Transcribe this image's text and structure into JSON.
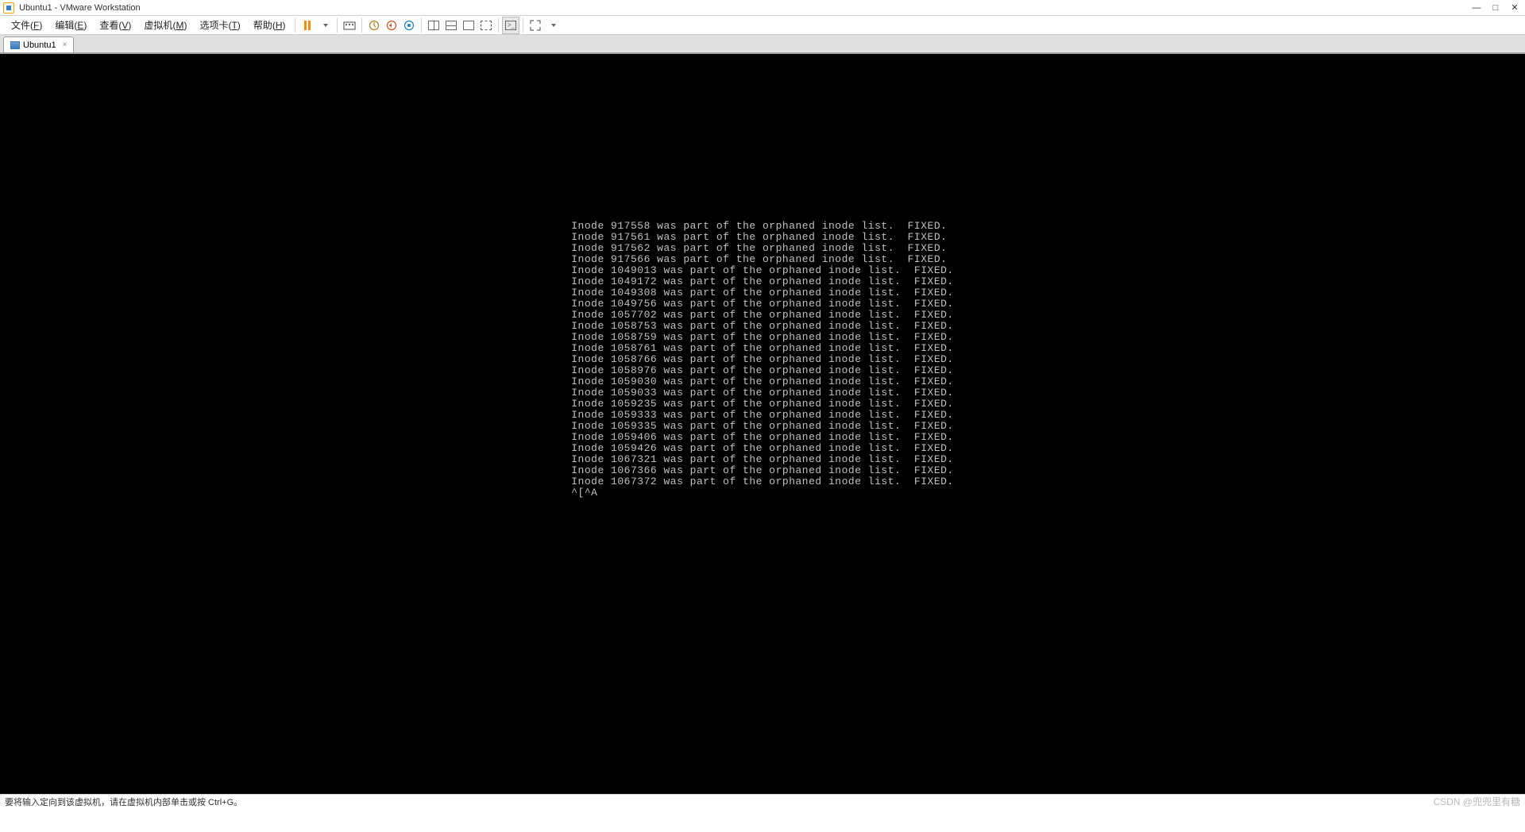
{
  "window": {
    "title": "Ubuntu1 - VMware Workstation"
  },
  "menu": {
    "file": {
      "label": "文件",
      "key": "F"
    },
    "edit": {
      "label": "编辑",
      "key": "E"
    },
    "view": {
      "label": "查看",
      "key": "V"
    },
    "vm": {
      "label": "虚拟机",
      "key": "M"
    },
    "tabs": {
      "label": "选项卡",
      "key": "T"
    },
    "help": {
      "label": "帮助",
      "key": "H"
    }
  },
  "tab": {
    "label": "Ubuntu1"
  },
  "console": {
    "lines": [
      "Inode 917558 was part of the orphaned inode list.  FIXED.",
      "Inode 917561 was part of the orphaned inode list.  FIXED.",
      "Inode 917562 was part of the orphaned inode list.  FIXED.",
      "Inode 917566 was part of the orphaned inode list.  FIXED.",
      "Inode 1049013 was part of the orphaned inode list.  FIXED.",
      "Inode 1049172 was part of the orphaned inode list.  FIXED.",
      "Inode 1049308 was part of the orphaned inode list.  FIXED.",
      "Inode 1049756 was part of the orphaned inode list.  FIXED.",
      "Inode 1057702 was part of the orphaned inode list.  FIXED.",
      "Inode 1058753 was part of the orphaned inode list.  FIXED.",
      "Inode 1058759 was part of the orphaned inode list.  FIXED.",
      "Inode 1058761 was part of the orphaned inode list.  FIXED.",
      "Inode 1058766 was part of the orphaned inode list.  FIXED.",
      "Inode 1058976 was part of the orphaned inode list.  FIXED.",
      "Inode 1059030 was part of the orphaned inode list.  FIXED.",
      "Inode 1059033 was part of the orphaned inode list.  FIXED.",
      "Inode 1059235 was part of the orphaned inode list.  FIXED.",
      "Inode 1059333 was part of the orphaned inode list.  FIXED.",
      "Inode 1059335 was part of the orphaned inode list.  FIXED.",
      "Inode 1059406 was part of the orphaned inode list.  FIXED.",
      "Inode 1059426 was part of the orphaned inode list.  FIXED.",
      "Inode 1067321 was part of the orphaned inode list.  FIXED.",
      "Inode 1067366 was part of the orphaned inode list.  FIXED.",
      "Inode 1067372 was part of the orphaned inode list.  FIXED.",
      "^[^A"
    ]
  },
  "status": {
    "message": "要将输入定向到该虚拟机，请在虚拟机内部单击或按 Ctrl+G。",
    "watermark": "CSDN @兜兜里有糖"
  }
}
